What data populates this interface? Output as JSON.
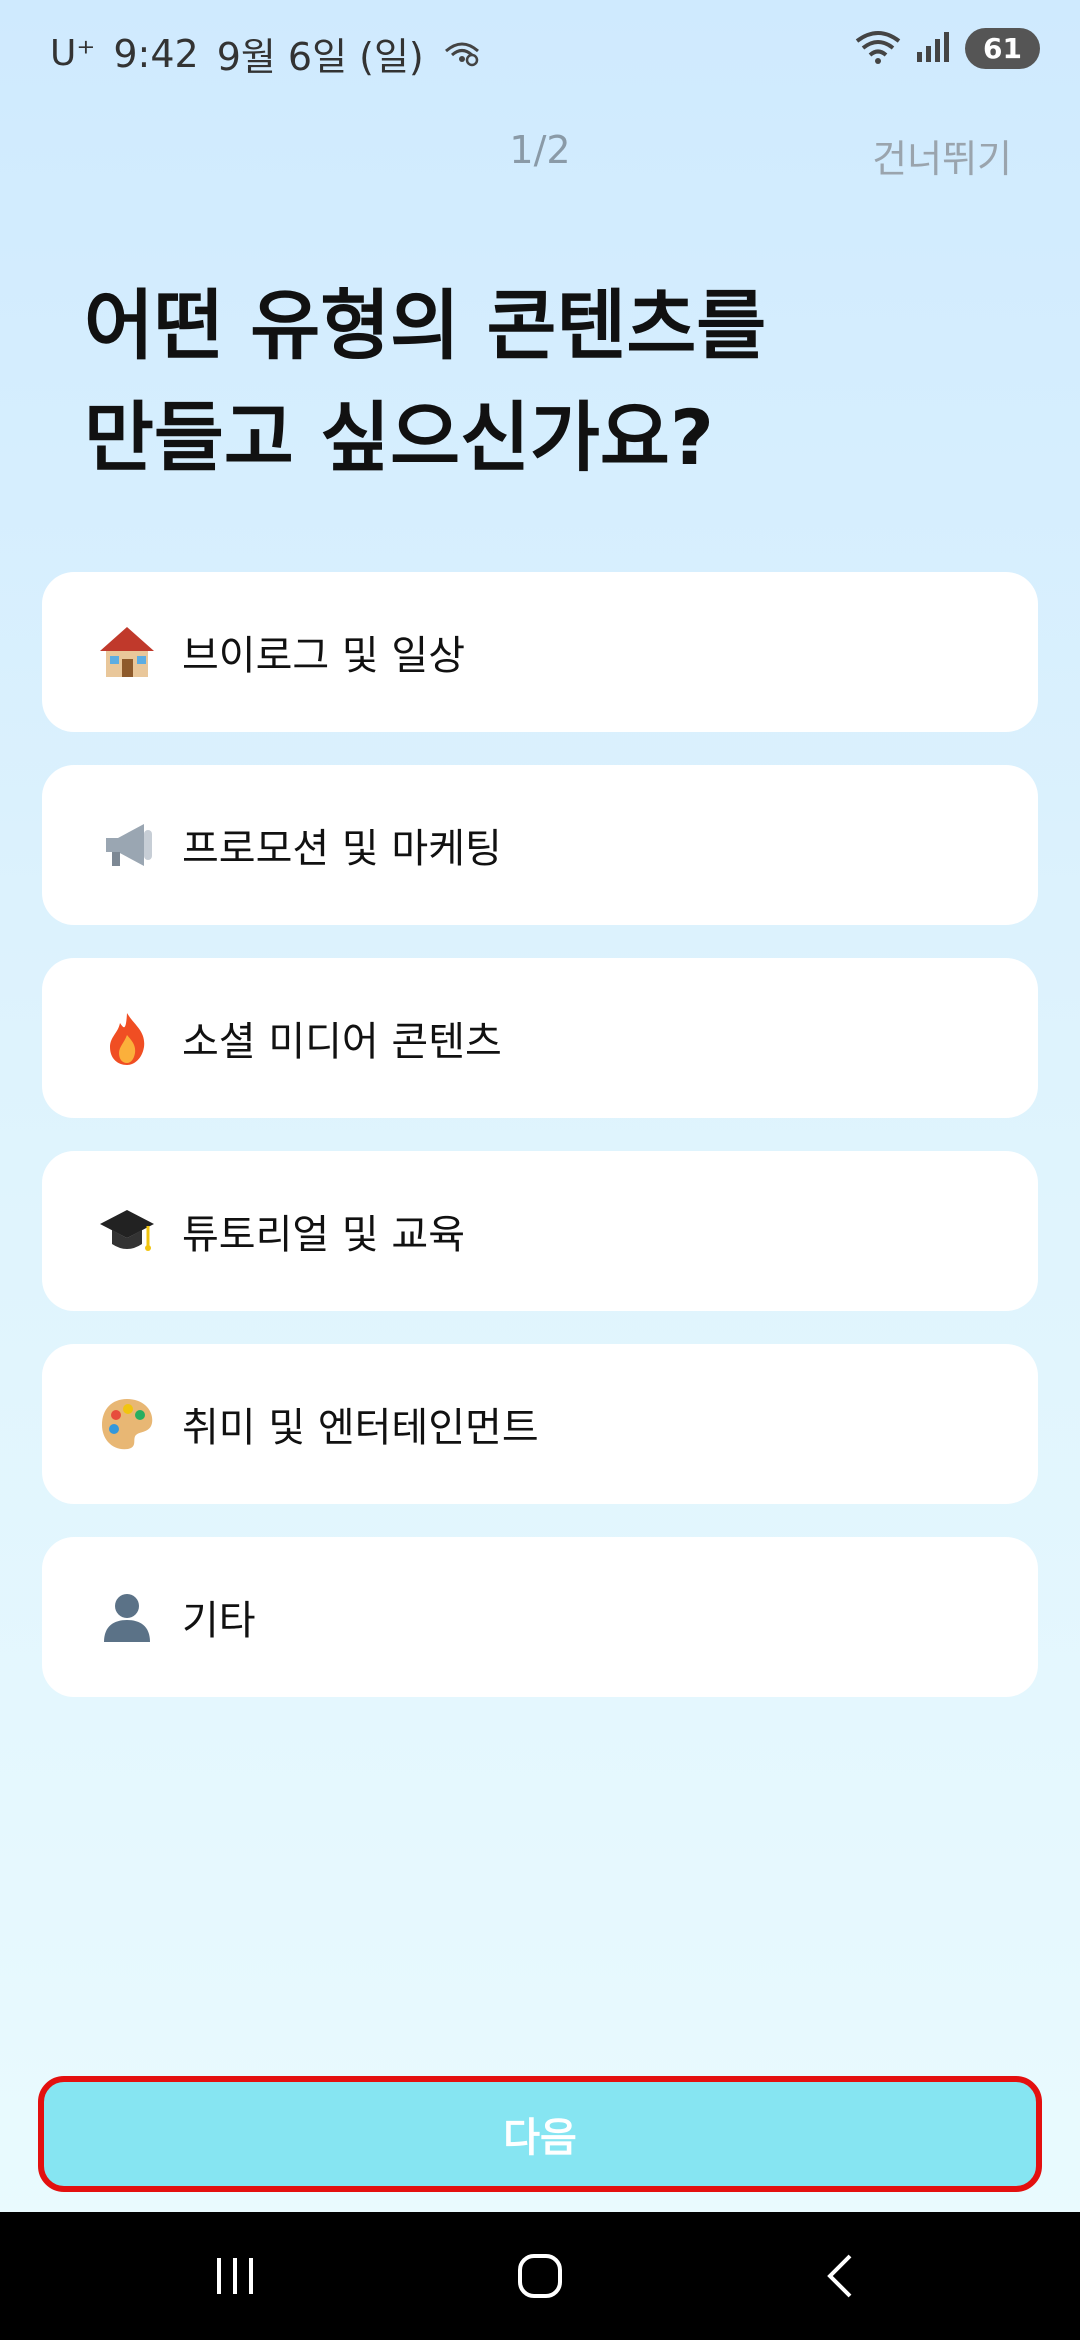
{
  "status_bar": {
    "carrier": "U⁺",
    "time": "9:42",
    "date": "9월 6일 (일)",
    "battery": "61"
  },
  "header": {
    "progress": "1/2",
    "skip_label": "건너뛰기"
  },
  "title": "어떤 유형의 콘텐츠를\n만들고 싶으신가요?",
  "options": [
    {
      "icon": "house-icon",
      "label": "브이로그 및 일상"
    },
    {
      "icon": "megaphone-icon",
      "label": "프로모션 및 마케팅"
    },
    {
      "icon": "fire-icon",
      "label": "소셜 미디어 콘텐츠"
    },
    {
      "icon": "graduation-cap-icon",
      "label": "튜토리얼 및 교육"
    },
    {
      "icon": "palette-icon",
      "label": "취미 및 엔터테인먼트"
    },
    {
      "icon": "person-icon",
      "label": "기타"
    }
  ],
  "next_button": {
    "label": "다음"
  },
  "colors": {
    "accent": "#86e5f2",
    "highlight_border": "#e3100f",
    "background_top": "#cfeafe",
    "background_bottom": "#eafbfe"
  }
}
